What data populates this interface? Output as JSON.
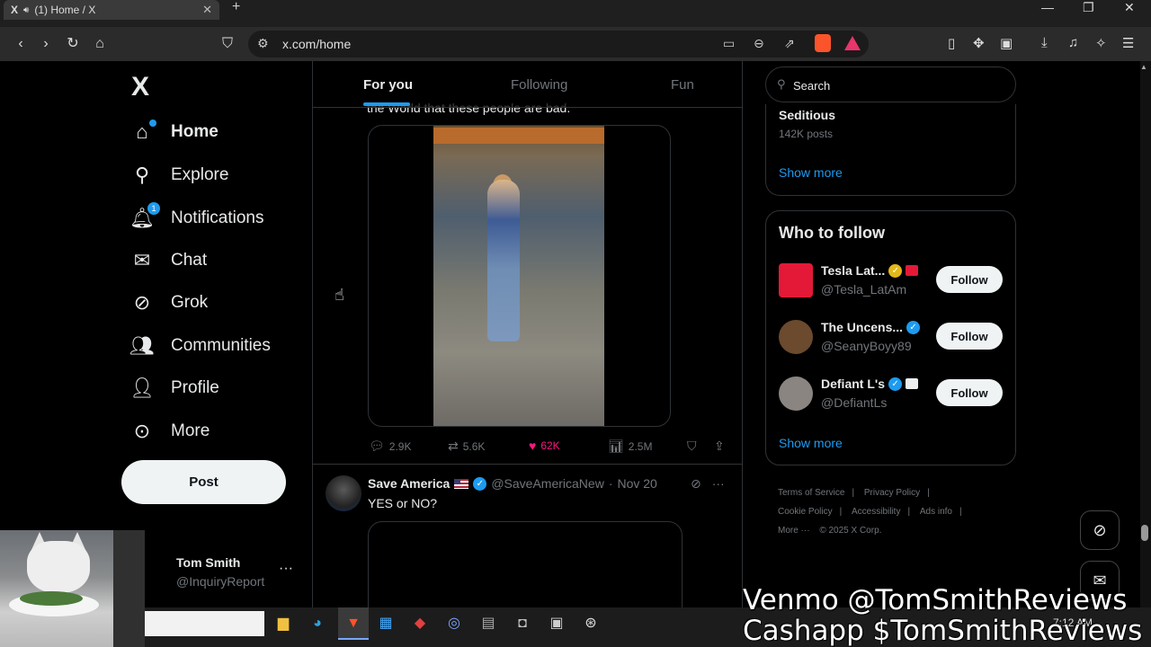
{
  "browser": {
    "tab_title": "(1) Home / X",
    "tab_logo": "X",
    "url": "x.com/home"
  },
  "sidebar": {
    "logo": "X",
    "items": [
      {
        "label": "Home",
        "icon": "home-icon",
        "active": true
      },
      {
        "label": "Explore",
        "icon": "search-icon"
      },
      {
        "label": "Notifications",
        "icon": "bell-icon",
        "badge": "1"
      },
      {
        "label": "Chat",
        "icon": "mail-icon"
      },
      {
        "label": "Grok",
        "icon": "grok-icon"
      },
      {
        "label": "Communities",
        "icon": "people-icon"
      },
      {
        "label": "Profile",
        "icon": "person-icon"
      },
      {
        "label": "More",
        "icon": "more-circle-icon"
      }
    ],
    "post_label": "Post",
    "account": {
      "name": "Tom Smith",
      "handle": "@InquiryReport"
    }
  },
  "feed": {
    "tabs": [
      "For you",
      "Following",
      "Fun"
    ],
    "active_tab": "For you",
    "ghost_text": "the World that these people are bad.",
    "tweet1": {
      "replies": "2.9K",
      "reposts": "5.6K",
      "likes": "62K",
      "views": "2.5M"
    },
    "tweet2": {
      "author": "Save America",
      "handle": "@SaveAmericaNew",
      "date": "Nov 20",
      "text": "YES or NO?"
    }
  },
  "right": {
    "search_placeholder": "Search",
    "trend": {
      "title": "Seditious",
      "count": "142K posts"
    },
    "show_more": "Show more",
    "who_to_follow_title": "Who to follow",
    "follow_label": "Follow",
    "suggestions": [
      {
        "name": "Tesla Lat...",
        "handle": "@Tesla_LatAm",
        "avatar_color": "#e31937",
        "verified": "gold"
      },
      {
        "name": "The Uncens...",
        "handle": "@SeanyBoyy89",
        "avatar_color": "#6b4a2e",
        "verified": "blue"
      },
      {
        "name": "Defiant L's",
        "handle": "@DefiantLs",
        "avatar_color": "#8a8580",
        "verified": "blue"
      }
    ],
    "footer": [
      "Terms of Service",
      "Privacy Policy",
      "Cookie Policy",
      "Accessibility",
      "Ads info",
      "More ···",
      "© 2025 X Corp."
    ]
  },
  "taskbar": {
    "clock": "7:12 AM"
  },
  "overlay": {
    "venmo": "Venmo @TomSmithReviews",
    "cashapp": "Cashapp $TomSmithReviews"
  },
  "colors": {
    "accent": "#1d9bf0",
    "like": "#f91880",
    "bg": "#000000"
  }
}
